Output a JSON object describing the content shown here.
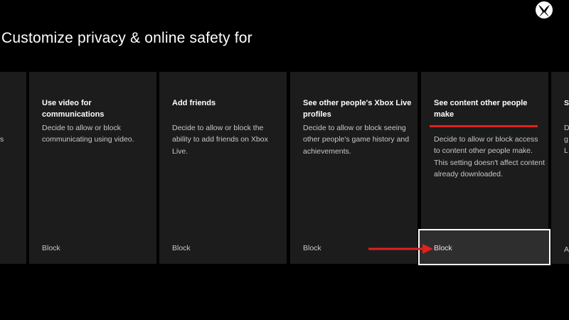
{
  "header": {
    "title": "Customize privacy & online safety for",
    "logo_icon": "xbox-logo-icon"
  },
  "cards": [
    {
      "title": "",
      "description": "",
      "value": ""
    },
    {
      "title": "Use video for communications",
      "description": "Decide to allow or block communicating using video.",
      "value": "Block"
    },
    {
      "title": "Add friends",
      "description": "Decide to allow or block the ability to add friends on Xbox Live.",
      "value": "Block"
    },
    {
      "title": "See other people's Xbox Live profiles",
      "description": "Decide to allow or block seeing other people's game history and achievements.",
      "value": "Block"
    },
    {
      "title": "See content other people make",
      "description": "Decide to allow or block access to content other people make. This setting doesn't affect content already downloaded.",
      "value": "Block"
    },
    {
      "title": "",
      "description": "",
      "value": ""
    }
  ],
  "partial_left": {
    "line1": "",
    "line2": "s"
  },
  "partial_right": {
    "title": "S",
    "desc1": "D",
    "desc2": "g",
    "desc3": "L",
    "value": "A"
  },
  "annotations": {
    "arrow_color": "#e0211f",
    "underline_color": "#e0211f"
  },
  "colors": {
    "background": "#000000",
    "card": "#1c1c1c",
    "focus_border": "#ffffff"
  }
}
